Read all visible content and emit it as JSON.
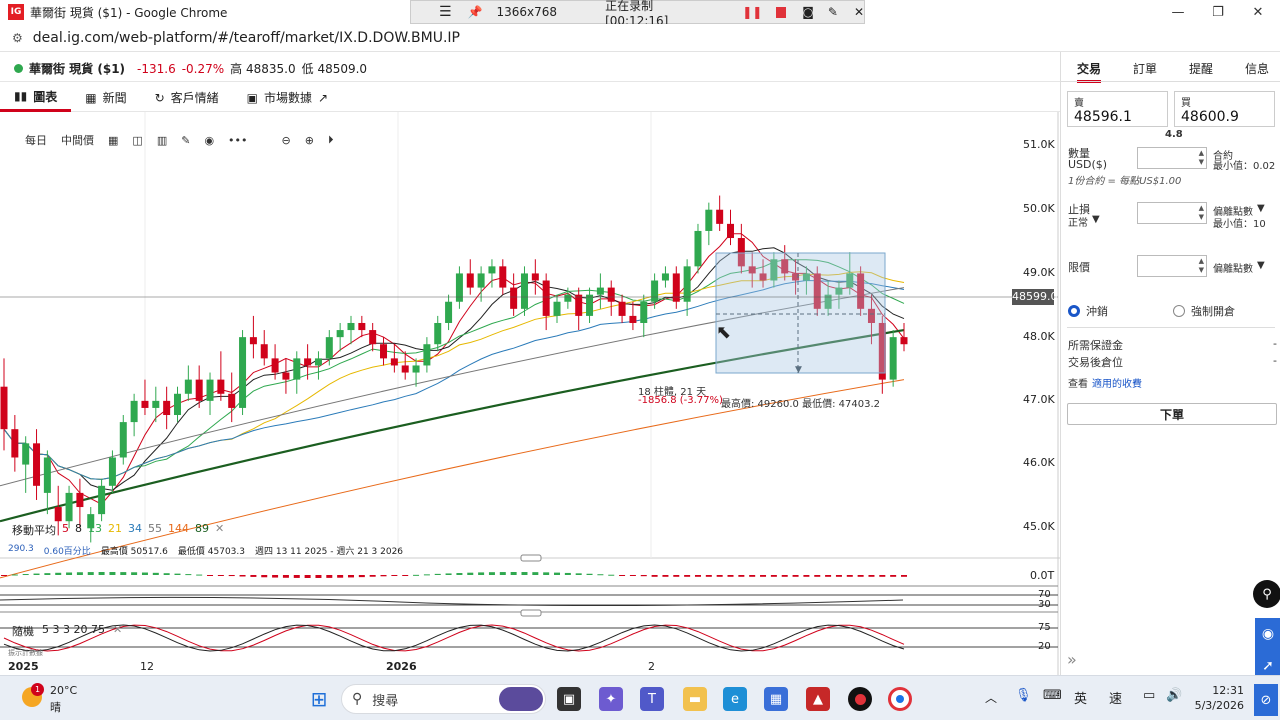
{
  "window": {
    "title": "華爾街 現貨 ($1) - Google Chrome",
    "logo": "IG"
  },
  "recorder": {
    "resolution": "1366x768",
    "status": "正在录制 [00:12:16]"
  },
  "address": {
    "url": "deal.ig.com/web-platform/#/tearoff/market/IX.D.DOW.BMU.IP"
  },
  "instrument": {
    "name": "華爾街 現貨 ($1)",
    "change": "-131.6",
    "change_pct": "-0.27%",
    "high": "高 48835.0",
    "low": "低 48509.0"
  },
  "tabs": [
    {
      "label": "圖表",
      "icon": "bar-chart-icon"
    },
    {
      "label": "新聞",
      "icon": "newspaper-icon"
    },
    {
      "label": "客戶情緒",
      "icon": "refresh-icon"
    },
    {
      "label": "市場數據",
      "icon": "calendar-icon"
    }
  ],
  "chart_toolbar": {
    "period": "每日",
    "price_type": "中間價"
  },
  "chart": {
    "ma_label": "移動平均",
    "ma_periods": [
      "5",
      "8",
      "13",
      "21",
      "34",
      "55",
      "144",
      "89"
    ],
    "ma_colors": [
      "#d0021b",
      "#222222",
      "#2fa84f",
      "#e6b800",
      "#2b7bb9",
      "#777777",
      "#e86a1a",
      "#1b5e20"
    ],
    "range_info": {
      "val": "290.3",
      "pct": "0.60百分比",
      "high": "最高價 50517.6",
      "low": "最低價 45703.3",
      "dates": "週四 13 11 2025 - 週六 21 3 2026"
    },
    "measure": {
      "bars": "18 柱體, 21 天",
      "change": "-1856.8 (-3.77%)",
      "high_low": "最高價: 49260.0 最低價: 47403.2"
    },
    "current_price": "48599.0",
    "y_ticks": [
      "51.0K",
      "50.0K",
      "49.0K",
      "48.0K",
      "47.0K",
      "46.0K",
      "45.0K"
    ],
    "x_ticks": [
      "2025",
      "12",
      "2026",
      "2"
    ],
    "macd_label": "0.0T",
    "rsi_levels": [
      "70",
      "30"
    ],
    "stoch": {
      "label": "隨機",
      "params": "5 3 3 20 75",
      "levels": [
        "75",
        "20"
      ],
      "extra": "振示計數據"
    }
  },
  "chart_data": {
    "type": "candlestick",
    "ylim": [
      45000,
      51300
    ],
    "candles": [
      [
        47900,
        48300,
        47000,
        47300
      ],
      [
        47300,
        47500,
        46700,
        46900
      ],
      [
        46800,
        47200,
        46400,
        47100
      ],
      [
        47100,
        47300,
        46300,
        46500
      ],
      [
        46400,
        47000,
        46100,
        46900
      ],
      [
        46200,
        46500,
        45800,
        46000
      ],
      [
        46000,
        46500,
        45900,
        46400
      ],
      [
        46400,
        46600,
        45900,
        46200
      ],
      [
        45900,
        46200,
        45700,
        46100
      ],
      [
        46100,
        46600,
        46000,
        46500
      ],
      [
        46500,
        47000,
        46400,
        46900
      ],
      [
        46900,
        47500,
        46800,
        47400
      ],
      [
        47400,
        47800,
        47200,
        47700
      ],
      [
        47700,
        48000,
        47500,
        47600
      ],
      [
        47600,
        47900,
        47400,
        47700
      ],
      [
        47700,
        47900,
        47300,
        47500
      ],
      [
        47500,
        47900,
        47400,
        47800
      ],
      [
        47800,
        48200,
        47700,
        48000
      ],
      [
        48000,
        48200,
        47600,
        47700
      ],
      [
        47700,
        48100,
        47500,
        48000
      ],
      [
        48000,
        48400,
        47700,
        47800
      ],
      [
        47800,
        48100,
        47400,
        47600
      ],
      [
        47600,
        48700,
        47500,
        48600
      ],
      [
        48600,
        48900,
        48300,
        48500
      ],
      [
        48500,
        48700,
        48200,
        48300
      ],
      [
        48300,
        48500,
        48000,
        48100
      ],
      [
        48100,
        48300,
        47800,
        48000
      ],
      [
        48000,
        48400,
        47800,
        48300
      ],
      [
        48300,
        48500,
        48000,
        48200
      ],
      [
        48200,
        48400,
        48000,
        48300
      ],
      [
        48300,
        48700,
        48200,
        48600
      ],
      [
        48600,
        48800,
        48400,
        48700
      ],
      [
        48700,
        48900,
        48500,
        48800
      ],
      [
        48800,
        48900,
        48600,
        48700
      ],
      [
        48700,
        48800,
        48400,
        48500
      ],
      [
        48500,
        48600,
        48200,
        48300
      ],
      [
        48300,
        48500,
        48100,
        48200
      ],
      [
        48200,
        48400,
        48000,
        48100
      ],
      [
        48100,
        48300,
        47900,
        48200
      ],
      [
        48200,
        48600,
        48100,
        48500
      ],
      [
        48500,
        48900,
        48400,
        48800
      ],
      [
        48800,
        49200,
        48700,
        49100
      ],
      [
        49100,
        49600,
        49000,
        49500
      ],
      [
        49500,
        49700,
        49200,
        49300
      ],
      [
        49300,
        49600,
        49100,
        49500
      ],
      [
        49500,
        49700,
        49300,
        49600
      ],
      [
        49600,
        49700,
        49200,
        49300
      ],
      [
        49300,
        49500,
        48900,
        49000
      ],
      [
        49000,
        49600,
        48900,
        49500
      ],
      [
        49500,
        49700,
        49200,
        49400
      ],
      [
        49400,
        49500,
        48700,
        48900
      ],
      [
        48900,
        49200,
        48800,
        49100
      ],
      [
        49100,
        49300,
        49000,
        49200
      ],
      [
        49200,
        49300,
        48700,
        48900
      ],
      [
        48900,
        49300,
        48800,
        49200
      ],
      [
        49200,
        49500,
        49000,
        49300
      ],
      [
        49300,
        49400,
        48900,
        49100
      ],
      [
        49100,
        49200,
        48800,
        48900
      ],
      [
        48900,
        49100,
        48700,
        48800
      ],
      [
        48800,
        49200,
        48600,
        49100
      ],
      [
        49100,
        49500,
        49000,
        49400
      ],
      [
        49400,
        49600,
        49300,
        49500
      ],
      [
        49500,
        49600,
        49000,
        49100
      ],
      [
        49100,
        49700,
        48900,
        49600
      ],
      [
        49600,
        50200,
        49500,
        50100
      ],
      [
        50100,
        50500,
        49900,
        50400
      ],
      [
        50400,
        50600,
        50100,
        50200
      ],
      [
        50200,
        50400,
        49900,
        50000
      ],
      [
        50000,
        50200,
        49500,
        49600
      ],
      [
        49600,
        49800,
        49300,
        49500
      ],
      [
        49500,
        49700,
        49300,
        49400
      ],
      [
        49400,
        49800,
        49300,
        49700
      ],
      [
        49700,
        49900,
        49400,
        49500
      ],
      [
        49500,
        49700,
        49200,
        49400
      ],
      [
        49400,
        49600,
        49200,
        49500
      ],
      [
        49500,
        49600,
        48900,
        49000
      ],
      [
        49000,
        49400,
        48900,
        49200
      ],
      [
        49200,
        49400,
        49000,
        49300
      ],
      [
        49300,
        49800,
        49200,
        49500
      ],
      [
        49500,
        49600,
        48900,
        49000
      ],
      [
        49000,
        49200,
        48500,
        48800
      ],
      [
        48800,
        48900,
        47800,
        48000
      ],
      [
        48000,
        48700,
        47900,
        48600
      ],
      [
        48600,
        48800,
        48400,
        48500
      ]
    ]
  },
  "trade_panel": {
    "tabs": [
      "交易",
      "訂單",
      "提醒",
      "信息"
    ],
    "sell_label": "賣",
    "sell_price": "48596.1",
    "buy_label": "買",
    "buy_price": "48600.9",
    "spread": "4.8",
    "qty_label": "數量",
    "qty_unit": "USD($)",
    "contract_label": "合約",
    "min_label": "最小值：0.02",
    "contract_note": "1份合約 = 每點US$1.00",
    "stop_label": "止損",
    "stop_type": "正常",
    "stop_dist_label": "偏離點數",
    "stop_min_label": "最小值：10",
    "limit_label": "限價",
    "limit_dist_label": "偏離點數",
    "close_option": "沖銷",
    "force_open_option": "強制開倉",
    "margin_label": "所需保證金",
    "margin_value": "-",
    "position_label": "交易後倉位",
    "position_value": "-",
    "fees_text": "查看",
    "fees_link": "適用的收費",
    "order_button": "下單"
  },
  "taskbar": {
    "temp": "20°C",
    "weather": "晴",
    "weather_badge": "1",
    "search_placeholder": "搜尋",
    "ime_lang": "英",
    "ime_mode": "速",
    "time": "12:31",
    "date": "5/3/2026"
  }
}
